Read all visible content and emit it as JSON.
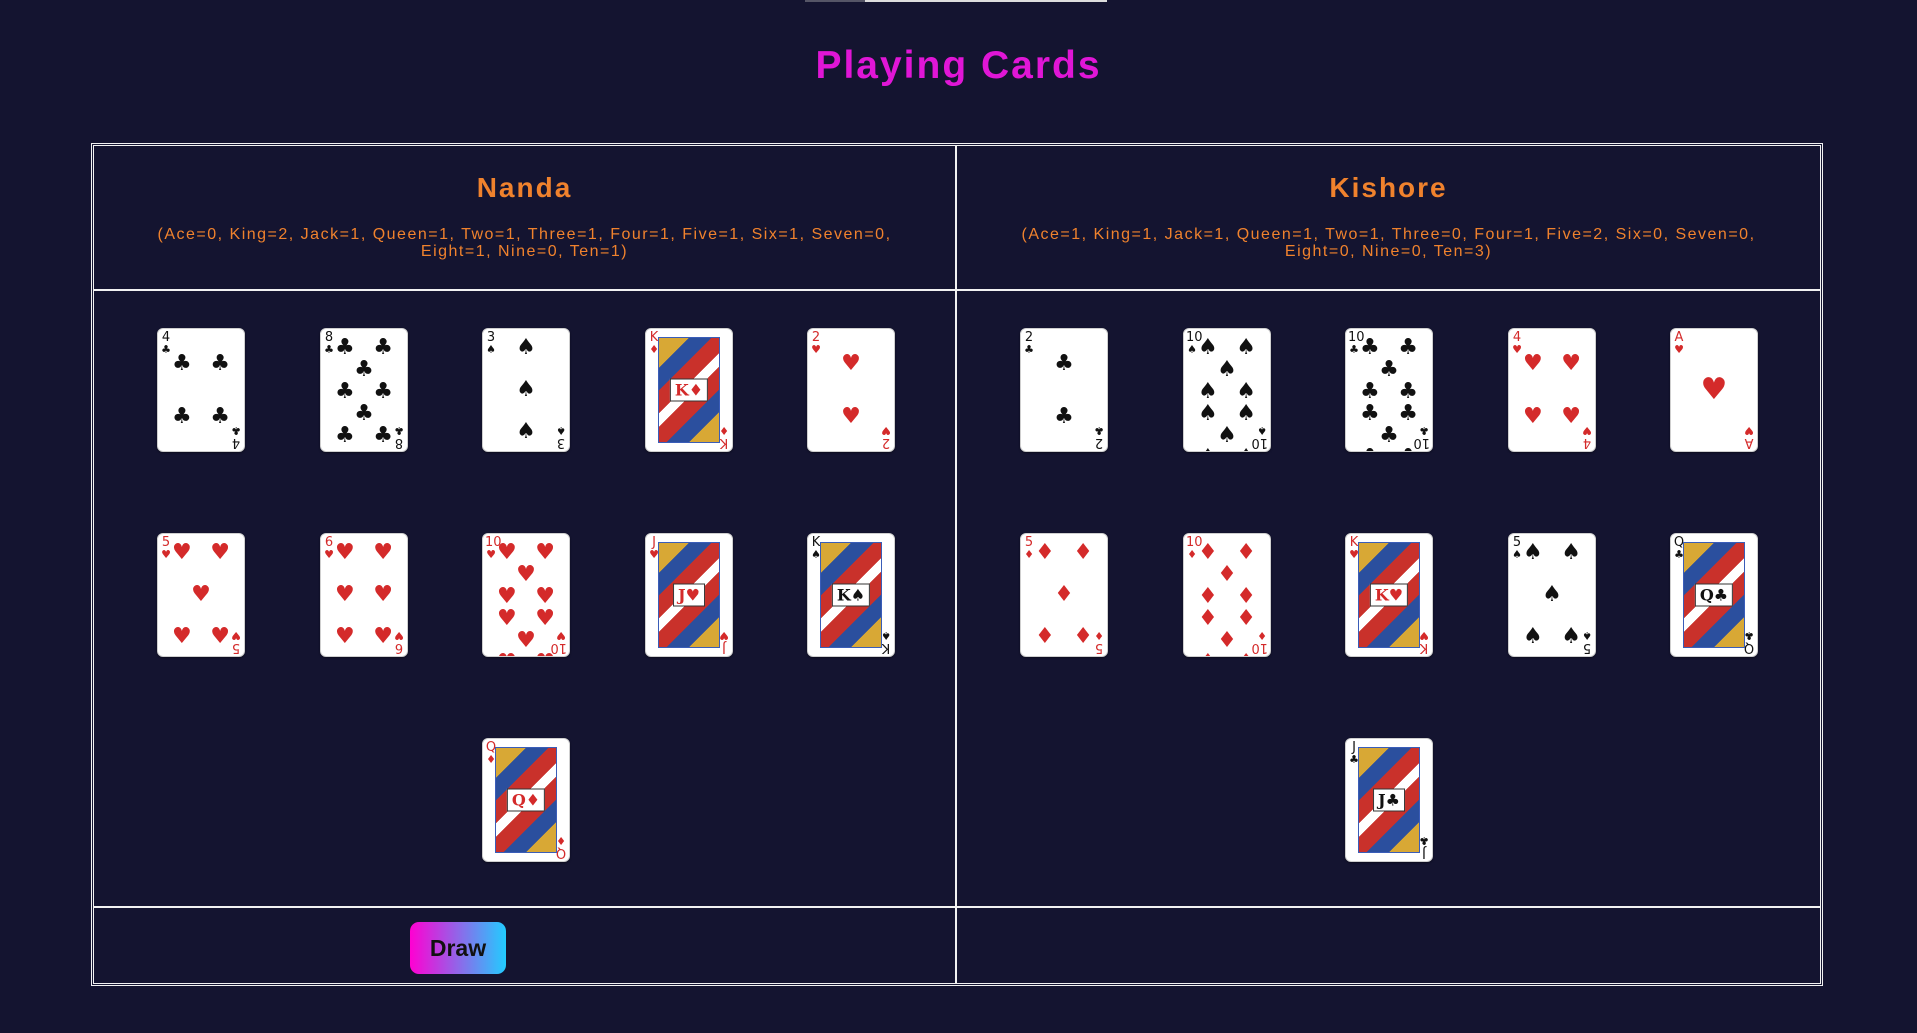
{
  "title": "Playing Cards",
  "draw_label": "Draw",
  "colors": {
    "background": "#141430",
    "title": "#e016d6",
    "player_text": "#f0822d"
  },
  "players": [
    {
      "name": "Nanda",
      "counts_line1": "(Ace=0, King=2, Jack=1, Queen=1, Two=1, Three=1, Four=1, Five=1, Six=1, Seven=0,",
      "counts_line2": "Eight=1, Nine=0, Ten=1)",
      "cards": [
        {
          "rank": "4",
          "suit": "clubs"
        },
        {
          "rank": "8",
          "suit": "clubs"
        },
        {
          "rank": "3",
          "suit": "spades"
        },
        {
          "rank": "K",
          "suit": "diamonds"
        },
        {
          "rank": "2",
          "suit": "hearts"
        },
        {
          "rank": "5",
          "suit": "hearts"
        },
        {
          "rank": "6",
          "suit": "hearts"
        },
        {
          "rank": "10",
          "suit": "hearts"
        },
        {
          "rank": "J",
          "suit": "hearts"
        },
        {
          "rank": "K",
          "suit": "spades"
        },
        {
          "rank": "Q",
          "suit": "diamonds"
        }
      ]
    },
    {
      "name": "Kishore",
      "counts_line1": "(Ace=1, King=1, Jack=1, Queen=1, Two=1, Three=0, Four=1, Five=2, Six=0, Seven=0,",
      "counts_line2": "Eight=0, Nine=0, Ten=3)",
      "cards": [
        {
          "rank": "2",
          "suit": "clubs"
        },
        {
          "rank": "10",
          "suit": "spades"
        },
        {
          "rank": "10",
          "suit": "clubs"
        },
        {
          "rank": "4",
          "suit": "hearts"
        },
        {
          "rank": "A",
          "suit": "hearts"
        },
        {
          "rank": "5",
          "suit": "diamonds"
        },
        {
          "rank": "10",
          "suit": "diamonds"
        },
        {
          "rank": "K",
          "suit": "hearts"
        },
        {
          "rank": "5",
          "suit": "spades"
        },
        {
          "rank": "Q",
          "suit": "clubs"
        },
        {
          "rank": "J",
          "suit": "clubs"
        }
      ]
    }
  ]
}
